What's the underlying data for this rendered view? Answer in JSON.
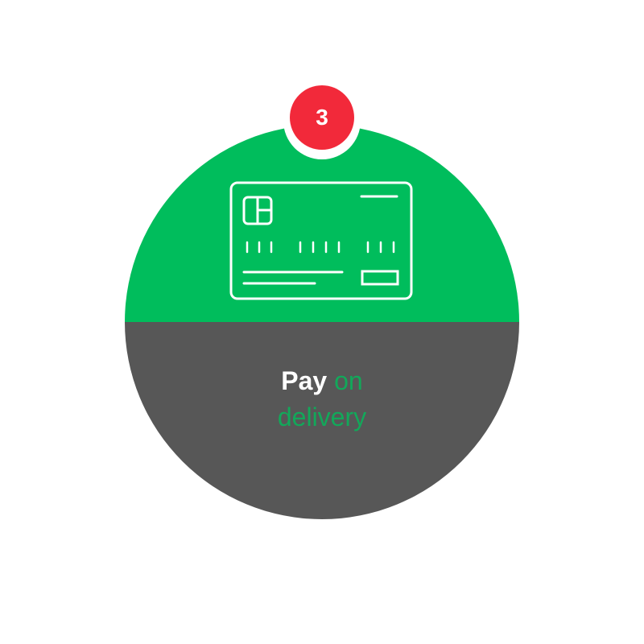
{
  "step": {
    "number": "3",
    "badge_color": "#f2293a"
  },
  "card": {
    "icon": "credit-card-icon",
    "top_color": "#00bd5c",
    "bottom_color": "#575757"
  },
  "label": {
    "word1": "Pay",
    "word2": "on",
    "word3": "delivery",
    "word1_color": "#ffffff",
    "accent_color": "#12a85a"
  }
}
